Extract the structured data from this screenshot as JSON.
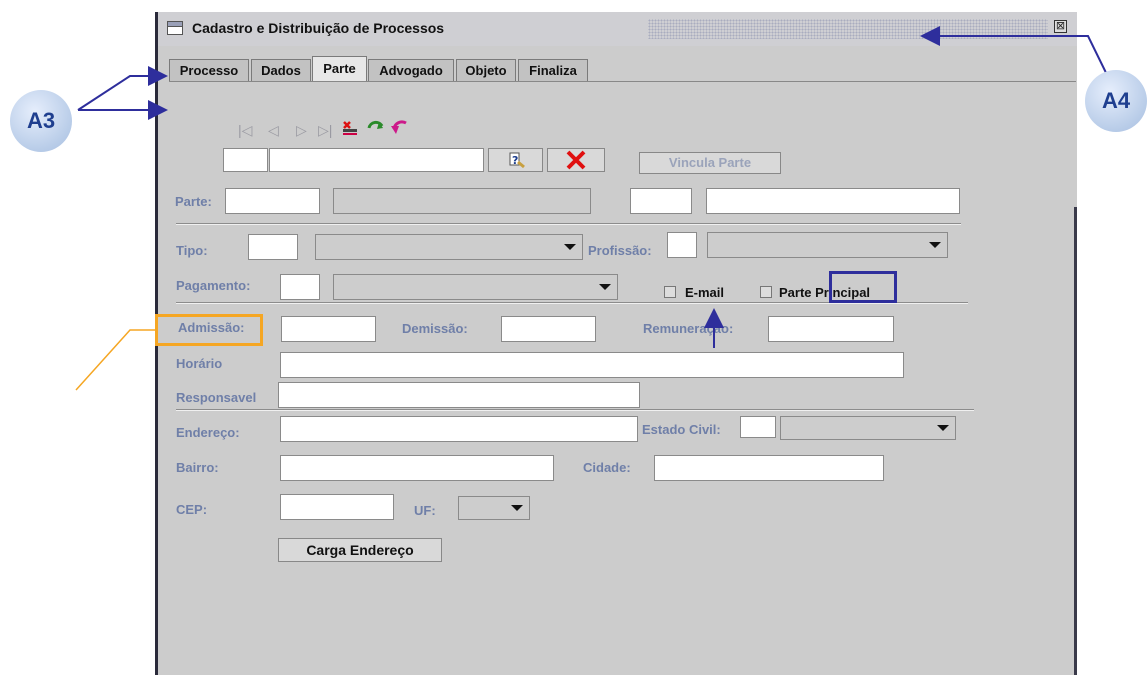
{
  "window": {
    "title": "Cadastro e Distribuição de Processos",
    "close_glyph": "⊠"
  },
  "tabs": [
    {
      "label": "Processo"
    },
    {
      "label": "Dados"
    },
    {
      "label": "Parte",
      "active": true
    },
    {
      "label": "Advogado"
    },
    {
      "label": "Objeto"
    },
    {
      "label": "Finaliza"
    }
  ],
  "toolbar": {
    "first": "|◁",
    "prev": "◁",
    "next": "▷",
    "last": "▷|",
    "icons": [
      "nav-first-icon",
      "nav-prev-icon",
      "nav-next-icon",
      "nav-last-icon",
      "delete-record-icon",
      "confirm-icon",
      "undo-icon"
    ]
  },
  "search": {
    "lookup_icon": "lookup-icon",
    "clear_icon": "clear-icon",
    "vincula_label": "Vincula Parte"
  },
  "form": {
    "parte_label": "Parte:",
    "tipo_label": "Tipo:",
    "profissao_label": "Profissão:",
    "pagamento_label": "Pagamento:",
    "email_label": "E-mail",
    "parte_principal_label": "Parte Principal",
    "admissao_label": "Admissão:",
    "demissao_label": "Demissão:",
    "remuneracao_label": "Remuneração:",
    "horario_label": "Horário",
    "responsavel_label": "Responsavel",
    "endereco_label": "Endereço:",
    "estado_civil_label": "Estado Civil:",
    "bairro_label": "Bairro:",
    "cidade_label": "Cidade:",
    "cep_label": "CEP:",
    "uf_label": "UF:",
    "carga_label": "Carga Endereço"
  },
  "annotations": {
    "a3": "A3",
    "a4": "A4",
    "colors": {
      "blue": "#2e2e9c",
      "orange": "#f5a623"
    }
  }
}
